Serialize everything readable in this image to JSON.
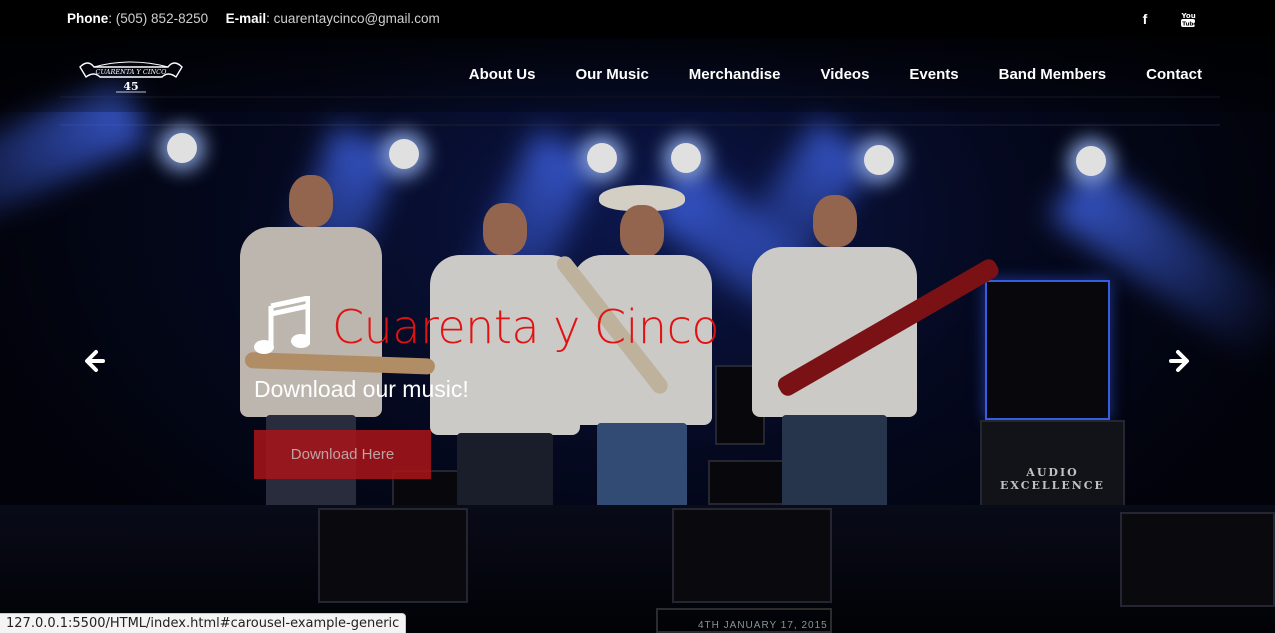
{
  "topbar": {
    "phone_label": "Phone",
    "phone_value": "(505) 852-8250",
    "email_label": "E-mail",
    "email_value": "cuarentaycinco@gmail.com",
    "social_icons": [
      "facebook-icon",
      "youtube-icon"
    ]
  },
  "logo": {
    "line1": "CUARENTA Y CINCO",
    "line2": "45"
  },
  "nav": {
    "items": [
      {
        "label": "About Us"
      },
      {
        "label": "Our Music"
      },
      {
        "label": "Merchandise"
      },
      {
        "label": "Videos"
      },
      {
        "label": "Events"
      },
      {
        "label": "Band Members"
      },
      {
        "label": "Contact"
      }
    ]
  },
  "carousel": {
    "title": "Cuarenta y Cinco",
    "subtitle": "Download our music!",
    "button_label": "Download Here",
    "icon": "music-note-icon",
    "prev_icon": "arrow-left-icon",
    "next_icon": "arrow-right-icon",
    "stage_banner": "4TH JANUARY 17, 2015",
    "amp_case_text": "AUDIO EXCELLENCE"
  },
  "status_url": "127.0.0.1:5500/HTML/index.html#carousel-example-generic",
  "colors": {
    "accent_red": "#e11212",
    "button_red": "#aa1419"
  }
}
